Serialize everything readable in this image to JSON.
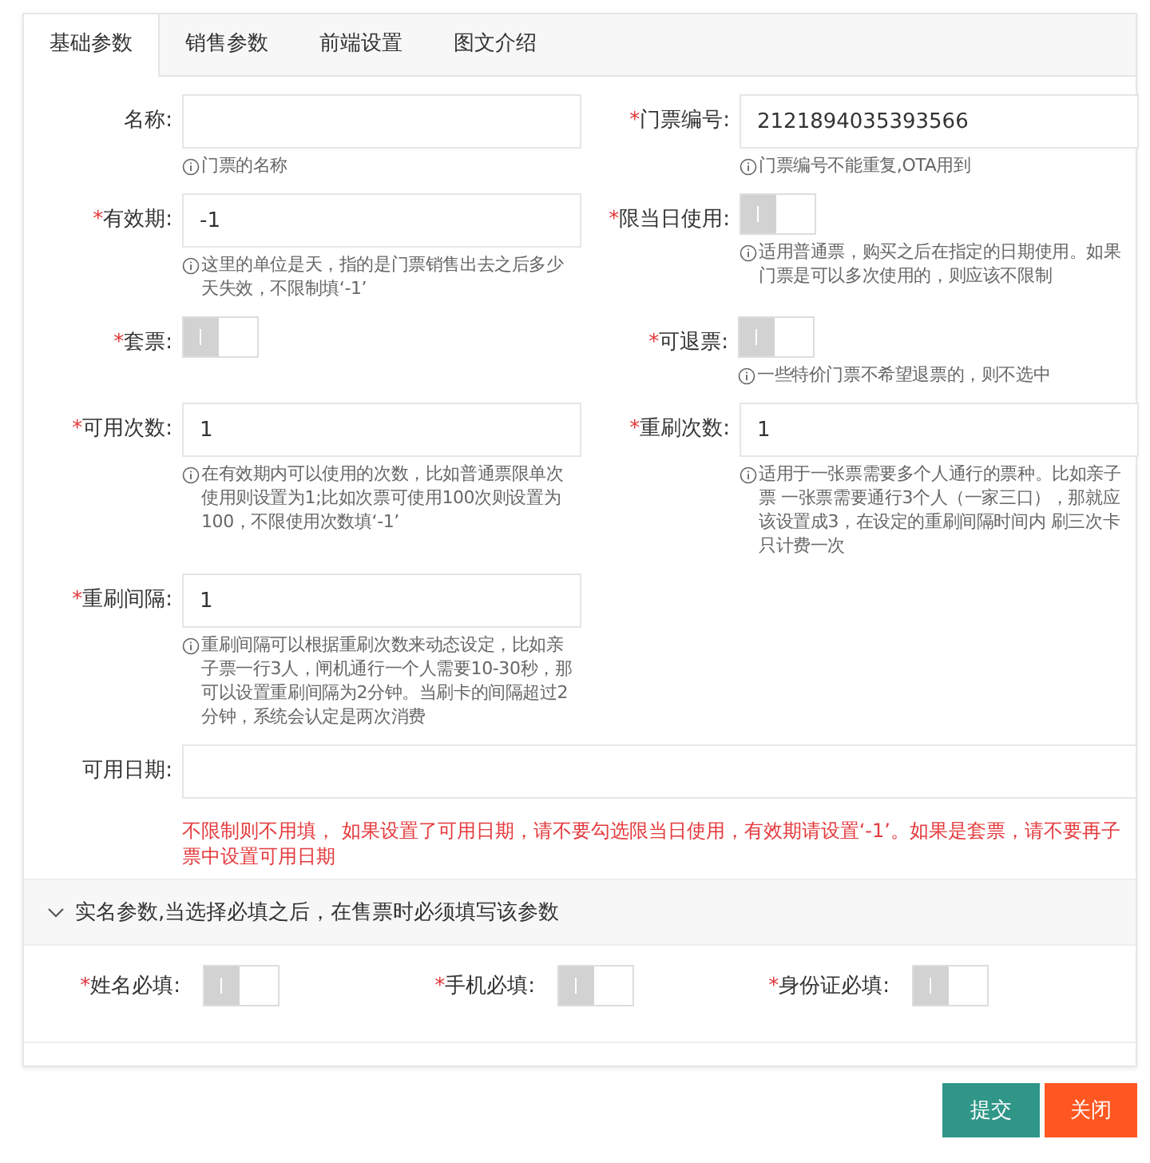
{
  "tabs": [
    {
      "label": "基础参数",
      "selected": true
    },
    {
      "label": "销售参数",
      "selected": false
    },
    {
      "label": "前端设置",
      "selected": false
    },
    {
      "label": "图文介绍",
      "selected": false
    }
  ],
  "rows": [
    {
      "fields": [
        {
          "kind": "input",
          "label": "名称:",
          "hint": "门票的名称"
        },
        {
          "kind": "input",
          "label": "门票编号:",
          "required_mark": "*",
          "value": "2121894035393566",
          "hint": "门票编号不能重复,OTA用到"
        }
      ]
    },
    {
      "fields": [
        {
          "kind": "input",
          "label": "有效期:",
          "required_mark": "*",
          "value": "-1",
          "hint": "这里的单位是天，指的是门票销售出去之后多少天失效，不限制填‘-1’"
        },
        {
          "kind": "toggle",
          "label": "限当日使用:",
          "required_mark": "*",
          "on": false,
          "hint": "适用普通票，购买之后在指定的日期使用。如果门票是可以多次使用的，则应该不限制"
        }
      ]
    },
    {
      "fields": [
        {
          "kind": "toggle",
          "label": "套票:",
          "required_mark": "*",
          "on": false
        },
        {
          "kind": "toggle",
          "label": "可退票:",
          "required_mark": "*",
          "on": false,
          "hint": "一些特价门票不希望退票的，则不选中"
        }
      ]
    },
    {
      "fields": [
        {
          "kind": "input",
          "label": "可用次数:",
          "required_mark": "*",
          "value": "1",
          "hint": "在有效期内可以使用的次数，比如普通票限单次使用则设置为1;比如次票可使用100次则设置为100，不限使用次数填‘-1’"
        },
        {
          "kind": "input",
          "label": "重刷次数:",
          "required_mark": "*",
          "value": "1",
          "hint": "适用于一张票需要多个人通行的票种。比如亲子票 一张票需要通行3个人（一家三口），那就应该设置成3，在设定的重刷间隔时间内 刷三次卡只计费一次"
        }
      ]
    },
    {
      "fields": [
        {
          "kind": "input",
          "label": "重刷间隔:",
          "required_mark": "*",
          "value": "1",
          "hint": "重刷间隔可以根据重刷次数来动态设定，比如亲子票一行3人，闸机通行一个人需要10-30秒，那可以设置重刷间隔为2分钟。当刷卡的间隔超过2分钟，系统会认定是两次消费"
        }
      ]
    }
  ],
  "date_field": {
    "label": "可用日期:",
    "note": "不限制则不用填， 如果设置了可用日期，请不要勾选限当日使用，有效期请设置‘-1’。如果是套票，请不要再子票中设置可用日期"
  },
  "realname": {
    "title": "实名参数,当选择必填之后，在售票时必须填写该参数",
    "expanded": true,
    "fields": [
      {
        "label": "姓名必填:",
        "required_mark": "*",
        "on": false
      },
      {
        "label": "手机必填:",
        "required_mark": "*",
        "on": false
      },
      {
        "label": "身份证必填:",
        "required_mark": "*",
        "on": false
      }
    ]
  },
  "buttons": [
    {
      "label": "提交",
      "kind": "primary"
    },
    {
      "label": "关闭",
      "kind": "danger"
    }
  ]
}
